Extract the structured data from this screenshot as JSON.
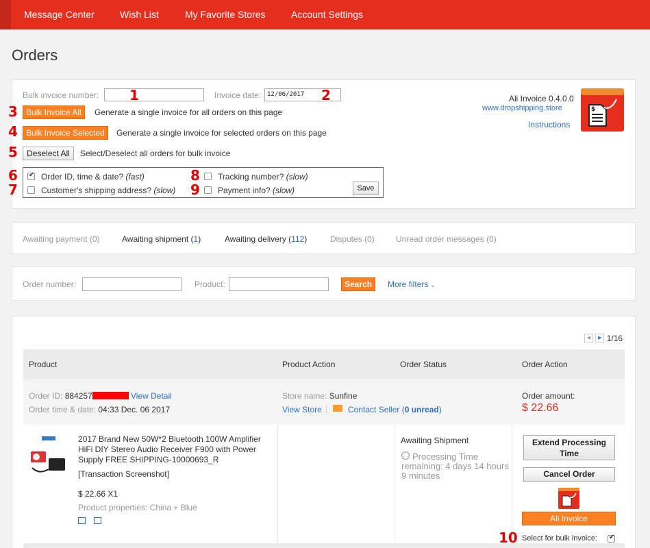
{
  "nav": {
    "items": [
      "Message Center",
      "Wish List",
      "My Favorite Stores",
      "Account Settings"
    ]
  },
  "page_title": "Orders",
  "invoice_tool": {
    "bulk_invoice_number_label": "Bulk invoice number:",
    "bulk_invoice_number_value": "",
    "invoice_date_label": "Invoice date:",
    "invoice_date_value": "12/06/2017",
    "bulk_all_button": "Bulk Invoice All",
    "bulk_all_desc": "Generate a single invoice for all orders on this page",
    "bulk_selected_button": "Bulk Invoice Selected",
    "bulk_selected_desc": "Generate a single invoice for selected orders on this page",
    "deselect_button": "Deselect All",
    "deselect_desc": "Select/Deselect all orders for bulk invoice",
    "options": [
      {
        "label": "Order ID, time & date? ",
        "note": "(fast)",
        "checked": true
      },
      {
        "label": "Customer's shipping address? ",
        "note": "(slow)",
        "checked": false
      },
      {
        "label": "Tracking number? ",
        "note": "(slow)",
        "checked": false
      },
      {
        "label": "Payment info? ",
        "note": "(slow)",
        "checked": false
      }
    ],
    "save_button": "Save",
    "plugin_name": "Ali Invoice 0.4.0.0",
    "plugin_site": "www.dropshipping.store",
    "instructions_link": "Instructions",
    "annotations": [
      "1",
      "2",
      "3",
      "4",
      "5",
      "6",
      "7",
      "8",
      "9",
      "10"
    ]
  },
  "tabs": {
    "awaiting_payment": "Awaiting payment (0)",
    "awaiting_shipment_label": "Awaiting shipment (",
    "awaiting_shipment_count": "1",
    "awaiting_delivery_label": "Awaiting delivery (",
    "awaiting_delivery_count": "112",
    "close_paren": ")",
    "disputes": "Disputes (0)",
    "unread": "Unread order messages (0)"
  },
  "search": {
    "order_number_label": "Order number:",
    "product_label": "Product:",
    "search_button": "Search",
    "more_filters": "More filters"
  },
  "pagination": {
    "text": "1/16"
  },
  "table": {
    "headers": [
      "Product",
      "Product Action",
      "Order Status",
      "Order Action"
    ]
  },
  "order": {
    "order_id_label": "Order ID: ",
    "order_id_value": "884257",
    "view_detail": "View Detail",
    "time_label": "Order time & date: ",
    "time_value": "04:33 Dec. 06 2017",
    "store_label": "Store name: ",
    "store_value": "Sunfine",
    "view_store": "View Store",
    "contact_seller_pre": "Contact Seller (",
    "contact_unread": "0 unread",
    "contact_seller_post": ")",
    "amount_label": "Order amount:",
    "amount_value": "$ 22.66",
    "product_title": "2017 Brand New 50W*2 Bluetooth 100W Amplifier HiFi DIY Stereo Audio Receiver F900 with Power Supply FREE SHIPPING-10000693_R",
    "transaction_screenshot": "[Transaction Screenshot]",
    "price_qty": "$ 22.66 X1",
    "properties": "Product properties: China + Blue",
    "status": "Awaiting Shipment",
    "processing_time": "Processing Time remaining: 4 days 14 hours 9 minutes",
    "extend_button": "Extend Processing Time",
    "cancel_button": "Cancel Order",
    "ali_invoice_button": "Ali Invoice",
    "bulk_select_label": "Select for bulk invoice:",
    "bulk_select_checked": true
  },
  "colors": {
    "brand_red": "#e62e1f",
    "orange": "#ff7f23",
    "link_blue": "#2e6fc2",
    "annotation_red": "#e00000"
  }
}
